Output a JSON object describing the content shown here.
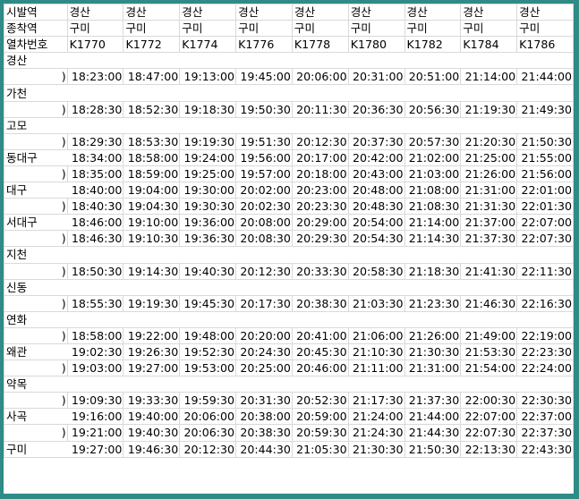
{
  "header": {
    "origin_label": "시발역",
    "dest_label": "종착역",
    "train_label": "열차번호",
    "origins": [
      "경산",
      "경산",
      "경산",
      "경산",
      "경산",
      "경산",
      "경산",
      "경산",
      "경산"
    ],
    "dests": [
      "구미",
      "구미",
      "구미",
      "구미",
      "구미",
      "구미",
      "구미",
      "구미",
      "구미"
    ],
    "trains": [
      "K1770",
      "K1772",
      "K1774",
      "K1776",
      "K1778",
      "K1780",
      "K1782",
      "K1784",
      "K1786"
    ]
  },
  "edge_mark": ")",
  "rows": [
    {
      "type": "station",
      "name": "경산"
    },
    {
      "type": "time",
      "times": [
        "18:23:00",
        "18:47:00",
        "19:13:00",
        "19:45:00",
        "20:06:00",
        "20:31:00",
        "20:51:00",
        "21:14:00",
        "21:44:00"
      ]
    },
    {
      "type": "station",
      "name": "가천"
    },
    {
      "type": "time",
      "times": [
        "18:28:30",
        "18:52:30",
        "19:18:30",
        "19:50:30",
        "20:11:30",
        "20:36:30",
        "20:56:30",
        "21:19:30",
        "21:49:30"
      ]
    },
    {
      "type": "station",
      "name": "고모"
    },
    {
      "type": "time",
      "times": [
        "18:29:30",
        "18:53:30",
        "19:19:30",
        "19:51:30",
        "20:12:30",
        "20:37:30",
        "20:57:30",
        "21:20:30",
        "21:50:30"
      ]
    },
    {
      "type": "stime",
      "name": "동대구",
      "times": [
        "18:34:00",
        "18:58:00",
        "19:24:00",
        "19:56:00",
        "20:17:00",
        "20:42:00",
        "21:02:00",
        "21:25:00",
        "21:55:00"
      ]
    },
    {
      "type": "time",
      "times": [
        "18:35:00",
        "18:59:00",
        "19:25:00",
        "19:57:00",
        "20:18:00",
        "20:43:00",
        "21:03:00",
        "21:26:00",
        "21:56:00"
      ]
    },
    {
      "type": "stime",
      "name": "대구",
      "times": [
        "18:40:00",
        "19:04:00",
        "19:30:00",
        "20:02:00",
        "20:23:00",
        "20:48:00",
        "21:08:00",
        "21:31:00",
        "22:01:00"
      ]
    },
    {
      "type": "time",
      "times": [
        "18:40:30",
        "19:04:30",
        "19:30:30",
        "20:02:30",
        "20:23:30",
        "20:48:30",
        "21:08:30",
        "21:31:30",
        "22:01:30"
      ]
    },
    {
      "type": "stime",
      "name": "서대구",
      "times": [
        "18:46:00",
        "19:10:00",
        "19:36:00",
        "20:08:00",
        "20:29:00",
        "20:54:00",
        "21:14:00",
        "21:37:00",
        "22:07:00"
      ]
    },
    {
      "type": "time",
      "times": [
        "18:46:30",
        "19:10:30",
        "19:36:30",
        "20:08:30",
        "20:29:30",
        "20:54:30",
        "21:14:30",
        "21:37:30",
        "22:07:30"
      ]
    },
    {
      "type": "station",
      "name": "지천"
    },
    {
      "type": "time",
      "times": [
        "18:50:30",
        "19:14:30",
        "19:40:30",
        "20:12:30",
        "20:33:30",
        "20:58:30",
        "21:18:30",
        "21:41:30",
        "22:11:30"
      ]
    },
    {
      "type": "station",
      "name": "신동"
    },
    {
      "type": "time",
      "times": [
        "18:55:30",
        "19:19:30",
        "19:45:30",
        "20:17:30",
        "20:38:30",
        "21:03:30",
        "21:23:30",
        "21:46:30",
        "22:16:30"
      ]
    },
    {
      "type": "station",
      "name": "연화"
    },
    {
      "type": "time",
      "times": [
        "18:58:00",
        "19:22:00",
        "19:48:00",
        "20:20:00",
        "20:41:00",
        "21:06:00",
        "21:26:00",
        "21:49:00",
        "22:19:00"
      ]
    },
    {
      "type": "stime",
      "name": "왜관",
      "times": [
        "19:02:30",
        "19:26:30",
        "19:52:30",
        "20:24:30",
        "20:45:30",
        "21:10:30",
        "21:30:30",
        "21:53:30",
        "22:23:30"
      ]
    },
    {
      "type": "time",
      "times": [
        "19:03:00",
        "19:27:00",
        "19:53:00",
        "20:25:00",
        "20:46:00",
        "21:11:00",
        "21:31:00",
        "21:54:00",
        "22:24:00"
      ]
    },
    {
      "type": "station",
      "name": "약목"
    },
    {
      "type": "time",
      "times": [
        "19:09:30",
        "19:33:30",
        "19:59:30",
        "20:31:30",
        "20:52:30",
        "21:17:30",
        "21:37:30",
        "22:00:30",
        "22:30:30"
      ]
    },
    {
      "type": "stime",
      "name": "사곡",
      "times": [
        "19:16:00",
        "19:40:00",
        "20:06:00",
        "20:38:00",
        "20:59:00",
        "21:24:00",
        "21:44:00",
        "22:07:00",
        "22:37:00"
      ]
    },
    {
      "type": "time",
      "times": [
        "19:21:00",
        "19:40:30",
        "20:06:30",
        "20:38:30",
        "20:59:30",
        "21:24:30",
        "21:44:30",
        "22:07:30",
        "22:37:30"
      ]
    },
    {
      "type": "stime",
      "name": "구미",
      "times": [
        "19:27:00",
        "19:46:30",
        "20:12:30",
        "20:44:30",
        "21:05:30",
        "21:30:30",
        "21:50:30",
        "22:13:30",
        "22:43:30"
      ]
    }
  ]
}
